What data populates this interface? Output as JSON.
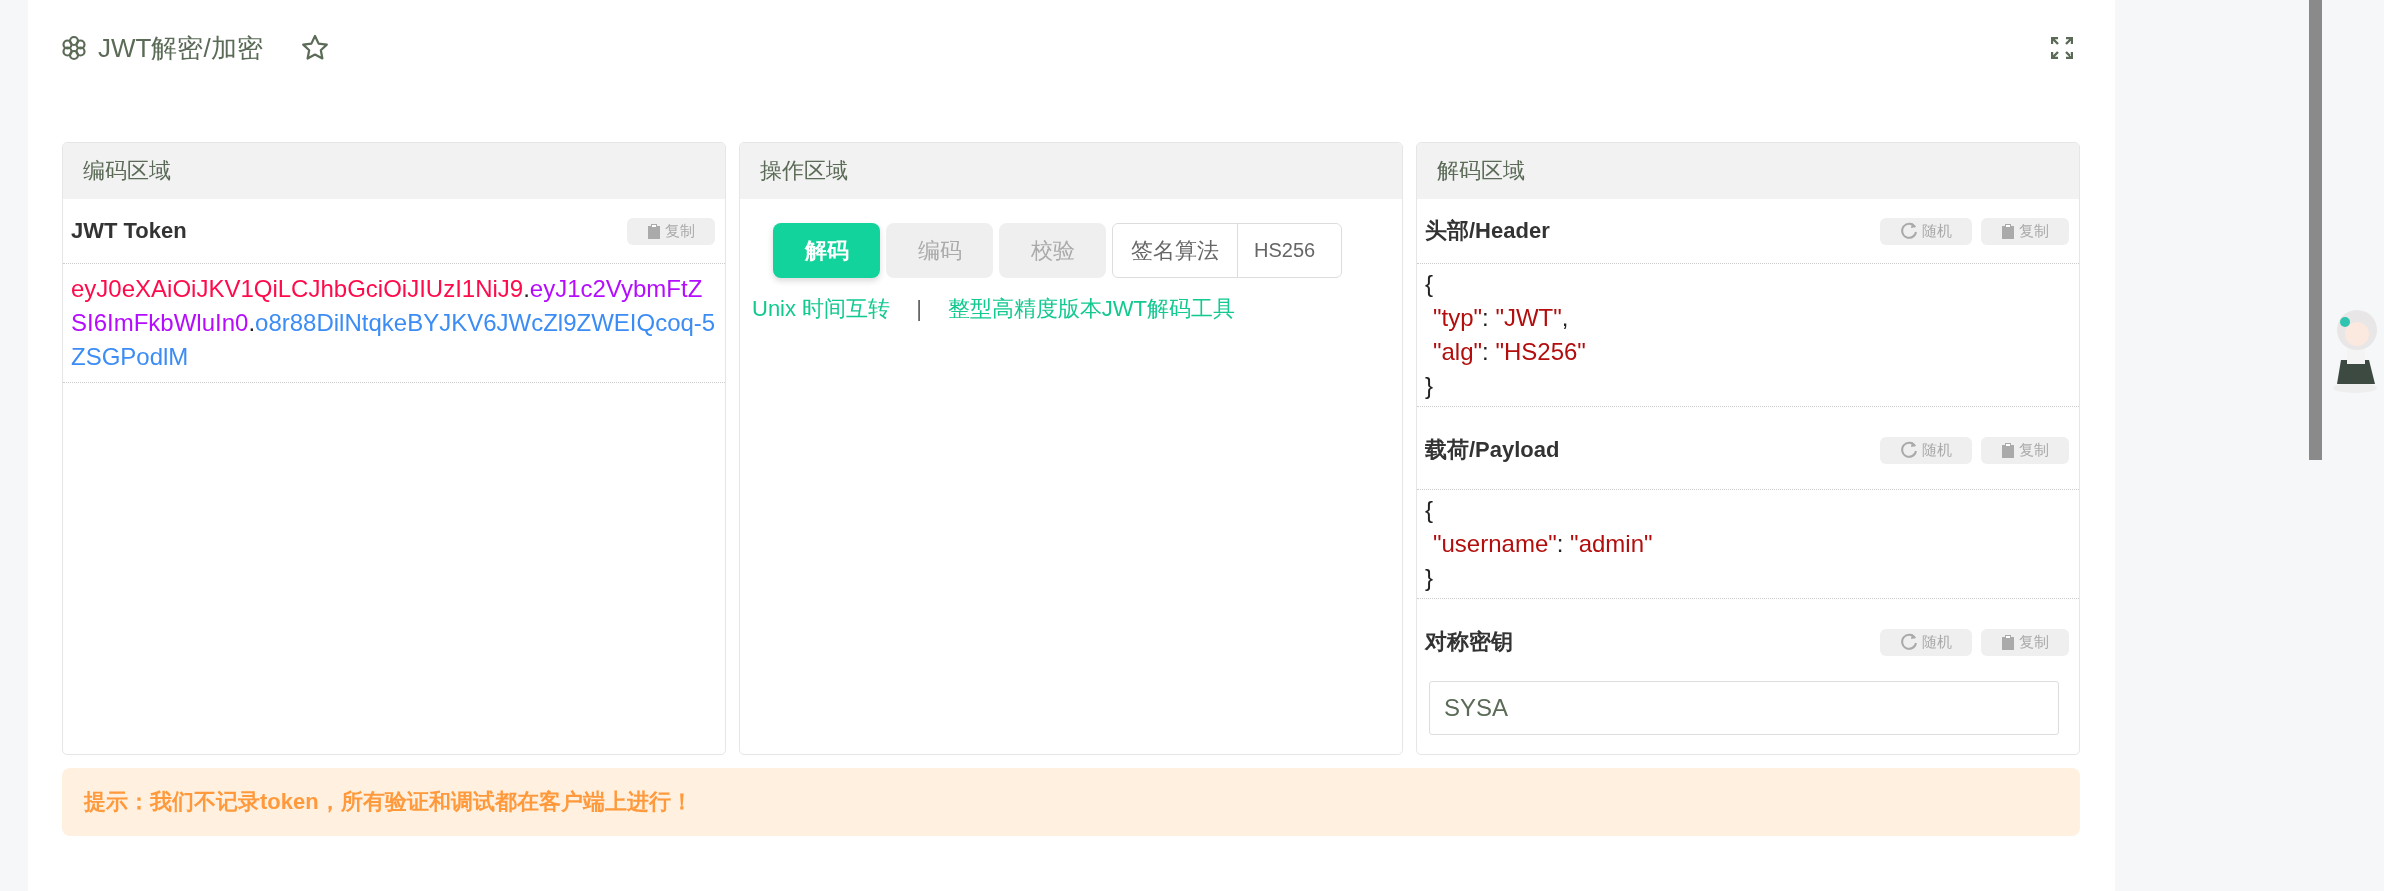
{
  "page": {
    "title": "JWT解密/加密"
  },
  "encode_panel": {
    "heading": "编码区域",
    "field_label": "JWT Token",
    "copy_button": "复制",
    "token_segments": [
      {
        "text": "eyJ0eXAiOiJKV1QiLCJhbGciOiJIUzI1NiJ9",
        "color": "#ff0a4a"
      },
      {
        "text": "."
      },
      {
        "text": "eyJ1c2VybmFtZSI6ImFkbWluIn0",
        "color": "#b40cff"
      },
      {
        "text": "."
      },
      {
        "text": "o8r88DilNtqkeBYJKV6JWcZl9ZWEIQcoq-5ZSGPodlM",
        "color": "#3b8cf5"
      }
    ]
  },
  "action_panel": {
    "heading": "操作区域",
    "modes": [
      {
        "label": "解码",
        "selected": true
      },
      {
        "label": "编码",
        "selected": false
      },
      {
        "label": "校验",
        "selected": false
      }
    ],
    "algorithm": {
      "label": "签名算法",
      "value": "HS256"
    },
    "links": [
      "Unix 时间互转",
      "整型高精度版本JWT解码工具"
    ],
    "link_separator": "|"
  },
  "decode_panel": {
    "heading": "解码区域",
    "sections": [
      {
        "kind": "json",
        "title": "头部/Header",
        "buttons": [
          {
            "kind": "refresh",
            "label": "随机"
          },
          {
            "kind": "copy",
            "label": "复制"
          }
        ],
        "lines": [
          {
            "kind": "brace",
            "text": "{"
          },
          {
            "kind": "pair",
            "key": "\"typ\"",
            "sep": ": ",
            "value": "\"JWT\"",
            "tail": ","
          },
          {
            "kind": "pair",
            "key": "\"alg\"",
            "sep": ": ",
            "value": "\"HS256\""
          },
          {
            "kind": "brace",
            "text": "}"
          }
        ]
      },
      {
        "kind": "json",
        "title": "载荷/Payload",
        "buttons": [
          {
            "kind": "refresh",
            "label": "随机"
          },
          {
            "kind": "copy",
            "label": "复制"
          }
        ],
        "lines": [
          {
            "kind": "brace",
            "text": "{"
          },
          {
            "kind": "pair",
            "key": "\"username\"",
            "sep": ": ",
            "value": "\"admin\""
          },
          {
            "kind": "brace",
            "text": "}"
          }
        ]
      },
      {
        "kind": "input",
        "title": "对称密钥",
        "buttons": [
          {
            "kind": "refresh",
            "label": "随机"
          },
          {
            "kind": "copy",
            "label": "复制"
          }
        ],
        "value": "SYSA"
      }
    ]
  },
  "notice": "提示：我们不记录token，所有验证和调试都在客户端上进行！"
}
